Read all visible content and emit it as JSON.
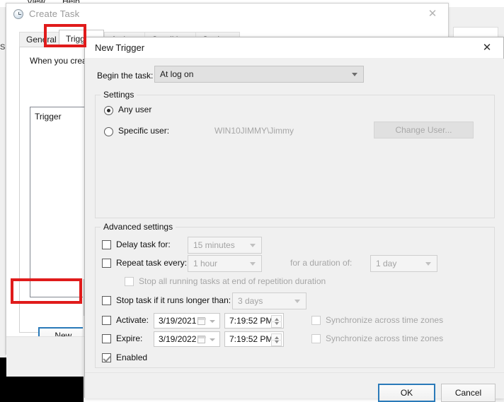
{
  "background_window": {
    "menu_items": [
      "View",
      "Help"
    ],
    "side_letters": "S"
  },
  "create_task_window": {
    "title": "Create Task",
    "close_icon": "close-icon",
    "tabs": [
      {
        "label": "General",
        "selected": false
      },
      {
        "label": "Triggers",
        "selected": true
      },
      {
        "label": "Actions",
        "selected": false
      },
      {
        "label": "Conditions",
        "selected": false
      },
      {
        "label": "Settings",
        "selected": false
      }
    ],
    "hint_text": "When you create",
    "list_header": "Trigger",
    "new_button": "New..."
  },
  "new_trigger_dialog": {
    "title": "New Trigger",
    "close_icon": "close-icon",
    "begin_task": {
      "label": "Begin the task:",
      "value": "At log on"
    },
    "settings_group": {
      "title": "Settings",
      "any_user": {
        "label": "Any user",
        "checked": true
      },
      "specific_user": {
        "label": "Specific user:",
        "checked": false
      },
      "user_value": "WIN10JIMMY\\Jimmy",
      "change_user_button": "Change User..."
    },
    "advanced_group": {
      "title": "Advanced settings",
      "delay_task": {
        "label": "Delay task for:",
        "checked": false,
        "value": "15 minutes"
      },
      "repeat_task": {
        "label": "Repeat task every:",
        "checked": false,
        "value": "1 hour"
      },
      "duration": {
        "label": "for a duration of:",
        "value": "1 day"
      },
      "stop_all": {
        "label": "Stop all running tasks at end of repetition duration",
        "checked": false
      },
      "stop_task": {
        "label": "Stop task if it runs longer than:",
        "checked": false,
        "value": "3 days"
      },
      "activate": {
        "label": "Activate:",
        "checked": false,
        "date": "3/19/2021",
        "time": "7:19:52 PM",
        "sync_label": "Synchronize across time zones",
        "sync_checked": false
      },
      "expire": {
        "label": "Expire:",
        "checked": false,
        "date": "3/19/2022",
        "time": "7:19:52 PM",
        "sync_label": "Synchronize across time zones",
        "sync_checked": false
      },
      "enabled": {
        "label": "Enabled",
        "checked": true
      }
    },
    "footer": {
      "ok_button": "OK",
      "cancel_button": "Cancel"
    }
  },
  "annotations": {
    "accent_red": "#e01b1b",
    "focus_blue": "#2a7ab9",
    "highlighted": [
      "triggers-tab",
      "new-button"
    ]
  }
}
